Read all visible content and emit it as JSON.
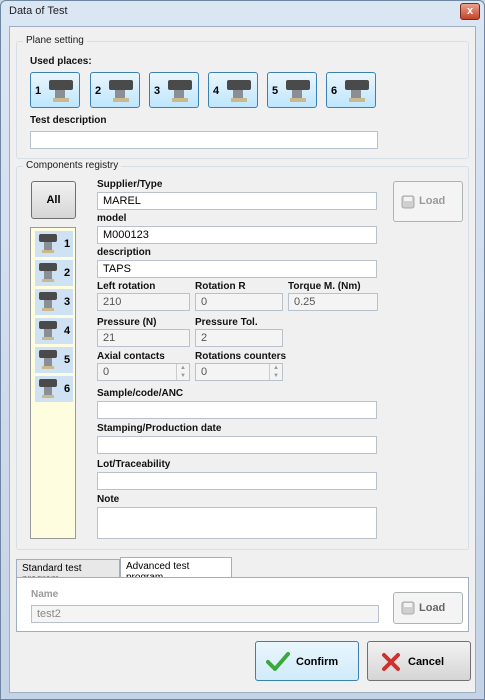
{
  "window": {
    "title": "Data of Test",
    "close_glyph": "x"
  },
  "plane_setting": {
    "title": "Plane setting",
    "used_places_label": "Used places:",
    "places": [
      "1",
      "2",
      "3",
      "4",
      "5",
      "6"
    ],
    "test_description_label": "Test description",
    "test_description_value": ""
  },
  "components": {
    "title": "Components registry",
    "all_label": "All",
    "list": [
      "1",
      "2",
      "3",
      "4",
      "5",
      "6"
    ],
    "load_label": "Load",
    "supplier_label": "Supplier/Type",
    "supplier_value": "MAREL",
    "model_label": "model",
    "model_value": "M000123",
    "description_label": "description",
    "description_value": "TAPS",
    "left_rotation_label": "Left rotation",
    "left_rotation_value": "210",
    "rotation_r_label": "Rotation R",
    "rotation_r_value": "0",
    "torque_label": "Torque M. (Nm)",
    "torque_value": "0.25",
    "pressure_label": "Pressure (N)",
    "pressure_value": "21",
    "pressure_tol_label": "Pressure Tol.",
    "pressure_tol_value": "2",
    "axial_label": "Axial contacts",
    "axial_value": "0",
    "rotation_counters_label": "Rotations counters",
    "rotation_counters_value": "0",
    "sample_label": "Sample/code/ANC",
    "sample_value": "",
    "stamping_label": "Stamping/Production date",
    "stamping_value": "",
    "lot_label": "Lot/Traceability",
    "lot_value": "",
    "note_label": "Note",
    "note_value": ""
  },
  "program": {
    "tabs": [
      "Standard test program",
      "Advanced test program"
    ],
    "active_tab": "Advanced test program",
    "name_label": "Name",
    "name_value": "test2",
    "load_label": "Load"
  },
  "footer": {
    "confirm_label": "Confirm",
    "cancel_label": "Cancel"
  },
  "colors": {
    "accent": "#3c7fb1",
    "list_bg": "#fffde0",
    "confirm_check": "#3aa83a",
    "cancel_x": "#d0312d"
  }
}
